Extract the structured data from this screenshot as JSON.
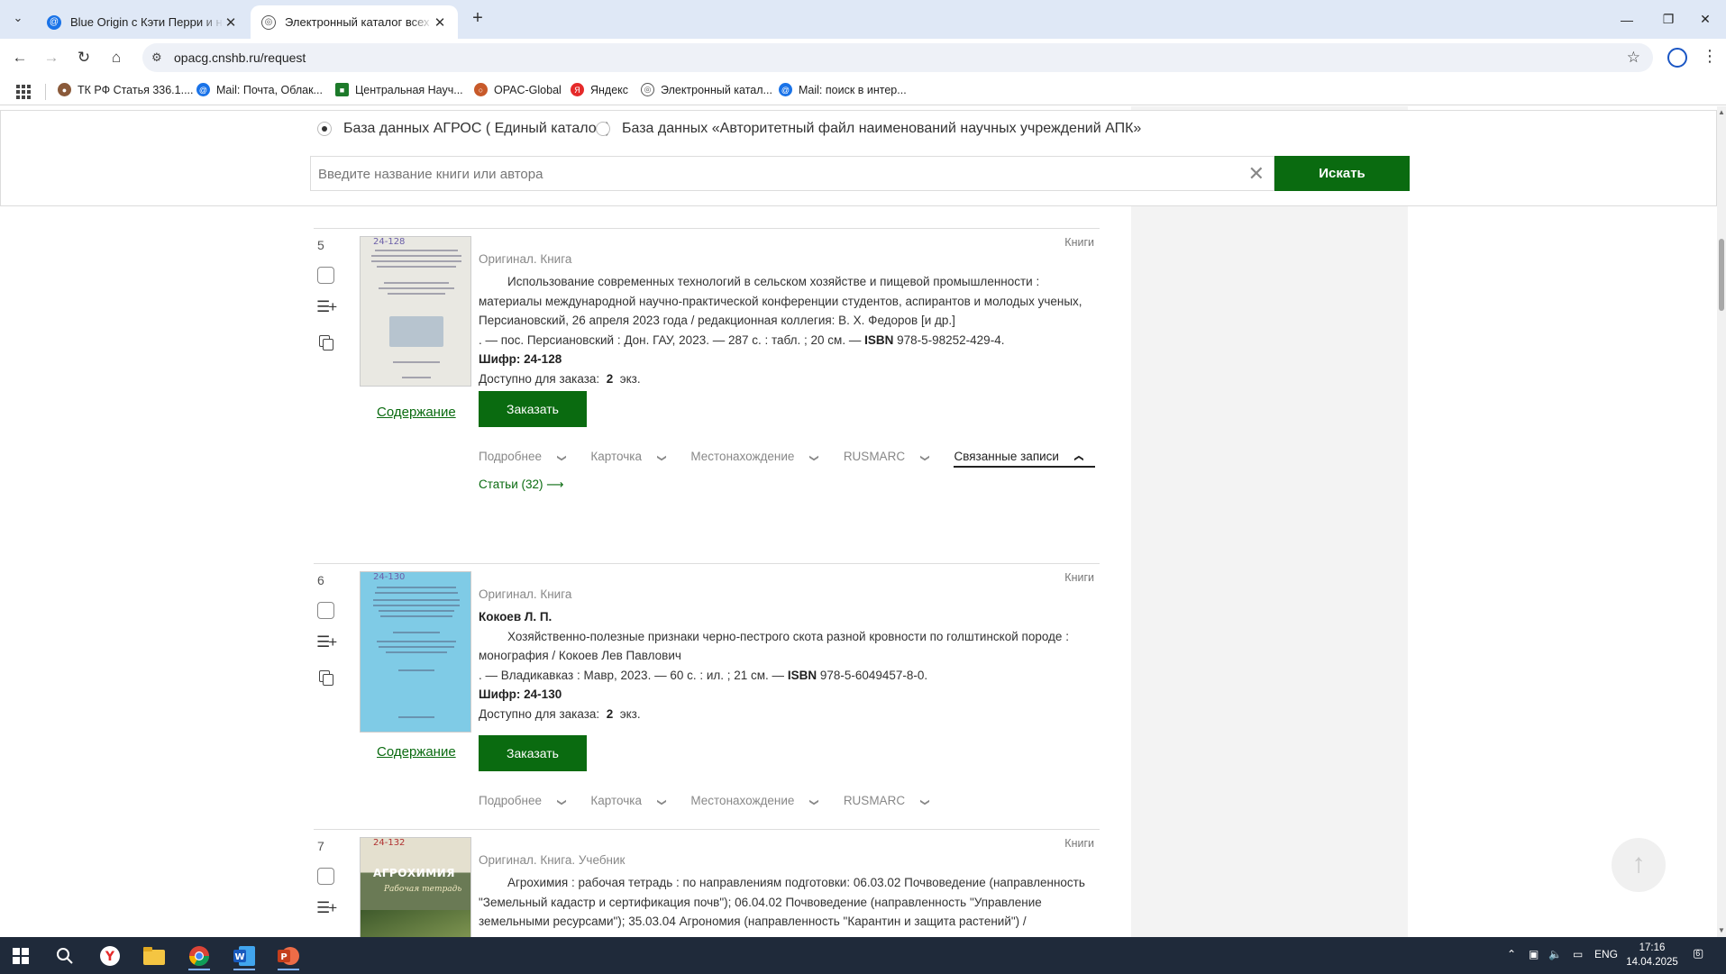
{
  "browser": {
    "tabs": [
      {
        "title": "Blue Origin с Кэти Перри и нев",
        "icon": "mail-icon"
      },
      {
        "title": "Электронный каталог всех вид",
        "icon": "globe-icon"
      }
    ],
    "url": "opacg.cnshb.ru/request",
    "bookmarks": [
      {
        "label": "ТК РФ Статья 336.1...."
      },
      {
        "label": "Mail: Почта, Облак..."
      },
      {
        "label": "Центральная Науч..."
      },
      {
        "label": "OPAC-Global"
      },
      {
        "label": "Яндекс"
      },
      {
        "label": "Электронный катал..."
      },
      {
        "label": "Mail: поиск в интер..."
      }
    ]
  },
  "search": {
    "db_options": [
      {
        "label": "База данных АГРОС ( Единый каталог )",
        "selected": true
      },
      {
        "label": "База данных «Авторитетный файл наименований научных учреждений АПК»",
        "selected": false
      }
    ],
    "placeholder": "Введите название книги или автора",
    "value": "",
    "button": "Искать"
  },
  "records": [
    {
      "number": "5",
      "type": "Книги",
      "meta": "Оригинал. Книга",
      "author": "",
      "title": "Использование современных технологий в сельском хозяйстве и пищевой промышленности :",
      "title_cont1": "материалы международной научно-практической конференции студентов, аспирантов и молодых ученых,",
      "title_cont2": "Персиановский, 26 апреля 2023 года / редакционная коллегия: В. Х. Федоров [и др.]",
      "pub": ". — пос. Персиановский : Дон. ГАУ, 2023. — 287 с. : табл. ; 20 см. — ",
      "isbn_label": "ISBN",
      "isbn": " 978-5-98252-429-4.",
      "shelf": "Шифр: 24-128",
      "availability_label": "Доступно для заказа:",
      "availability_count": "2",
      "availability_unit": "экз.",
      "contents_link": "Содержание",
      "order_button": "Заказать",
      "tabs": [
        "Подробнее",
        "Карточка",
        "Местонахождение",
        "RUSMARC",
        "Связанные записи"
      ],
      "active_tab": "Связанные записи",
      "related_link": "Статьи (32)",
      "cover_tag": "24-128"
    },
    {
      "number": "6",
      "type": "Книги",
      "meta": "Оригинал. Книга",
      "author": "Кокоев Л. П.",
      "title": "Хозяйственно-полезные признаки черно-пестрого скота разной кровности по голштинской породе :",
      "title_cont1": "монография / Кокоев Лев Павлович",
      "title_cont2": "",
      "pub": ". — Владикавказ : Мавр, 2023. — 60 с. : ил. ; 21 см. — ",
      "isbn_label": "ISBN",
      "isbn": " 978-5-6049457-8-0.",
      "shelf": "Шифр: 24-130",
      "availability_label": "Доступно для заказа:",
      "availability_count": "2",
      "availability_unit": "экз.",
      "contents_link": "Содержание",
      "order_button": "Заказать",
      "tabs": [
        "Подробнее",
        "Карточка",
        "Местонахождение",
        "RUSMARC"
      ],
      "cover_tag": "24-130"
    },
    {
      "number": "7",
      "type": "Книги",
      "meta": "Оригинал. Книга. Учебник",
      "title": "Агрохимия : рабочая тетрадь : по направлениям подготовки: 06.03.02 Почвоведение (направленность",
      "title_cont1": "\"Земельный кадастр и сертификация почв\"); 06.04.02 Почвоведение (направленность \"Управление",
      "title_cont2": "земельными ресурсами\"); 35.03.04 Агрономия (направленность \"Карантин и защита растений\") /",
      "cover_tag": "24-132",
      "cover_title": "АГРОХИМИЯ",
      "cover_subtitle": "Рабочая тетрадь"
    }
  ],
  "scroll_to_top": "↑",
  "taskbar": {
    "lang": "ENG",
    "time": "17:16",
    "date": "14.04.2025",
    "notifications": "6"
  },
  "colors": {
    "accent_green": "#0a6b10",
    "tab_strip": "#dfe8f6",
    "taskbar": "#1f2a3a"
  }
}
